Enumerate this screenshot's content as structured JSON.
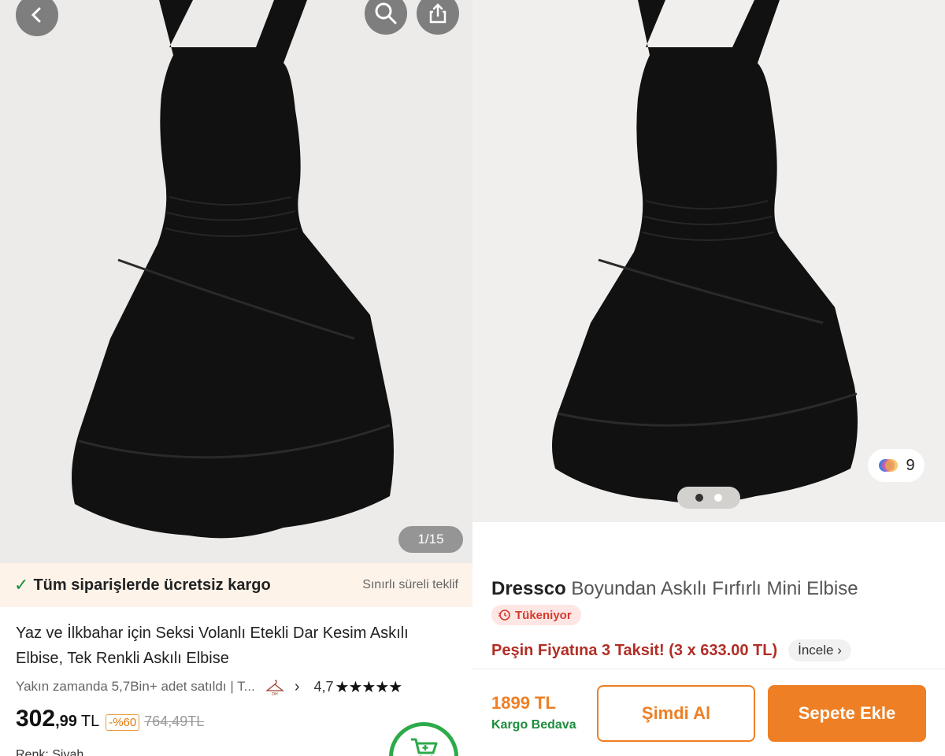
{
  "left": {
    "image_counter": "1/15",
    "shipping": {
      "check": "✓",
      "text": "Tüm siparişlerde ücretsiz kargo",
      "offer": "Sınırlı süreli teklif"
    },
    "title": "Yaz ve İlkbahar için Seksi Volanlı Etekli Dar Kesim Askılı Elbise, Tek Renkli Askılı Elbise",
    "meta": {
      "sold_text": "Yakın zamanda 5,7Bin+ adet satıldı | T...",
      "shop_logo": "DH Fashion",
      "chevron": "›",
      "rating": "4,7",
      "stars": "★★★★★"
    },
    "price": {
      "whole": "302",
      "decimal": ",99",
      "currency": "TL",
      "discount": "-%60",
      "old": "764,49TL"
    },
    "cut_text": "Renk: Siyah",
    "icons": [
      "back-icon",
      "search-icon",
      "share-icon",
      "cart-icon"
    ]
  },
  "right": {
    "brand": "Dressco",
    "product_name": "Boyundan Askılı Fırfırlı Mini Elbise",
    "badge": "Tükeniyor",
    "installment": "Peşin Fiyatına 3 Taksit! (3 x 633.00 TL)",
    "incele": "İncele ›",
    "color_count": "9",
    "price": "1899 TL",
    "shipping": "Kargo Bedava",
    "buy_now": "Şimdi Al",
    "add_to_cart": "Sepete Ekle",
    "carousel": {
      "total": 2,
      "active": 1
    }
  },
  "colors": {
    "accent": "#ee7f24",
    "green": "#1e8d3e",
    "red": "#b12e25",
    "shipping_bg": "#fdf3e9"
  }
}
